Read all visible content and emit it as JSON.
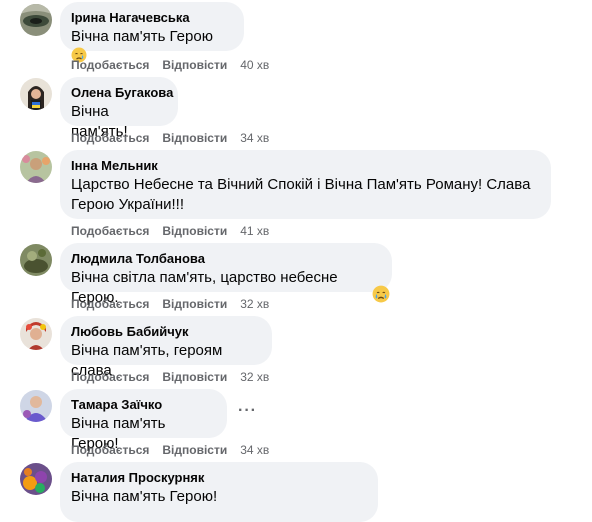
{
  "comments": [
    {
      "author": "Ірина Нагачевська",
      "text": "Вічна пам'ять Герою",
      "like": "Подобається",
      "reply": "Відповісти",
      "time": "40 хв",
      "emoji": "crying-face-emoji"
    },
    {
      "author": "Олена Бугакова",
      "text": "Вічна пам'ять!",
      "like": "Подобається",
      "reply": "Відповісти",
      "time": "34 хв"
    },
    {
      "author": "Інна Мельник",
      "text_line1": "Царство Небесне та Вічний Спокій і Вічна Пам'ять Роману! Слава",
      "text_line2": "Герою України!!!",
      "like": "Подобається",
      "reply": "Відповісти",
      "time": "41 хв"
    },
    {
      "author": "Людмила Толбанова",
      "text": "Вічна світла пам'ять, царство небесне Герою.",
      "like": "Подобається",
      "reply": "Відповісти",
      "time": "32 хв",
      "emoji": "crying-face-emoji"
    },
    {
      "author": "Любовь Бабийчук",
      "text": "Вічна пам'ять, героям слава",
      "like": "Подобається",
      "reply": "Відповісти",
      "time": "32 хв"
    },
    {
      "author": "Тамара Заїчко",
      "text": "Вічна пам'ять Герою!",
      "like": "Подобається",
      "reply": "Відповісти",
      "time": "34 хв",
      "more": "···"
    },
    {
      "author": "Наталия Проскурняк",
      "text": "Вічна пам'ять Герою!"
    }
  ],
  "colors": {
    "bubble": "#f0f2f5",
    "text": "#050505",
    "meta": "#65676b"
  }
}
